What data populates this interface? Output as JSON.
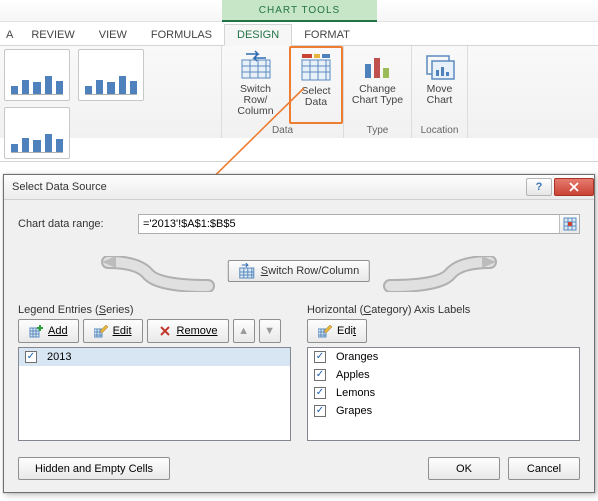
{
  "ribbon": {
    "contextual_title": "CHART TOOLS",
    "tabs": [
      "A",
      "REVIEW",
      "VIEW",
      "FORMULAS",
      "DESIGN",
      "FORMAT"
    ],
    "active_tab_index": 4,
    "groups": {
      "styles": {
        "label": ""
      },
      "data": {
        "label": "Data",
        "buttons": {
          "switch": {
            "line1": "Switch Row/",
            "line2": "Column"
          },
          "select": {
            "line1": "Select",
            "line2": "Data"
          }
        }
      },
      "type": {
        "label": "Type",
        "buttons": {
          "change": {
            "line1": "Change",
            "line2": "Chart Type"
          }
        }
      },
      "location": {
        "label": "Location",
        "buttons": {
          "move": {
            "line1": "Move",
            "line2": "Chart"
          }
        }
      }
    }
  },
  "dialog": {
    "title": "Select Data Source",
    "range": {
      "label": "Chart data range:",
      "value": "='2013'!$A$1:$B$5"
    },
    "switch_label_pre": "S",
    "switch_label_post": "witch Row/Column",
    "legend": {
      "heading_pre": "Legend Entries (",
      "heading_u": "S",
      "heading_post": "eries)",
      "buttons": {
        "add": "Add",
        "edit": "Edit",
        "remove": "Remove"
      },
      "series": [
        {
          "checked": true,
          "label": "2013"
        }
      ]
    },
    "axis": {
      "heading_pre": "Horizontal (",
      "heading_u": "C",
      "heading_post": "ategory) Axis Labels",
      "buttons": {
        "edit": "Edit"
      },
      "items": [
        {
          "checked": true,
          "label": "Oranges"
        },
        {
          "checked": true,
          "label": "Apples"
        },
        {
          "checked": true,
          "label": "Lemons"
        },
        {
          "checked": true,
          "label": "Grapes"
        }
      ]
    },
    "bottom": {
      "hidden": "Hidden and Empty Cells",
      "ok": "OK",
      "cancel": "Cancel"
    }
  }
}
